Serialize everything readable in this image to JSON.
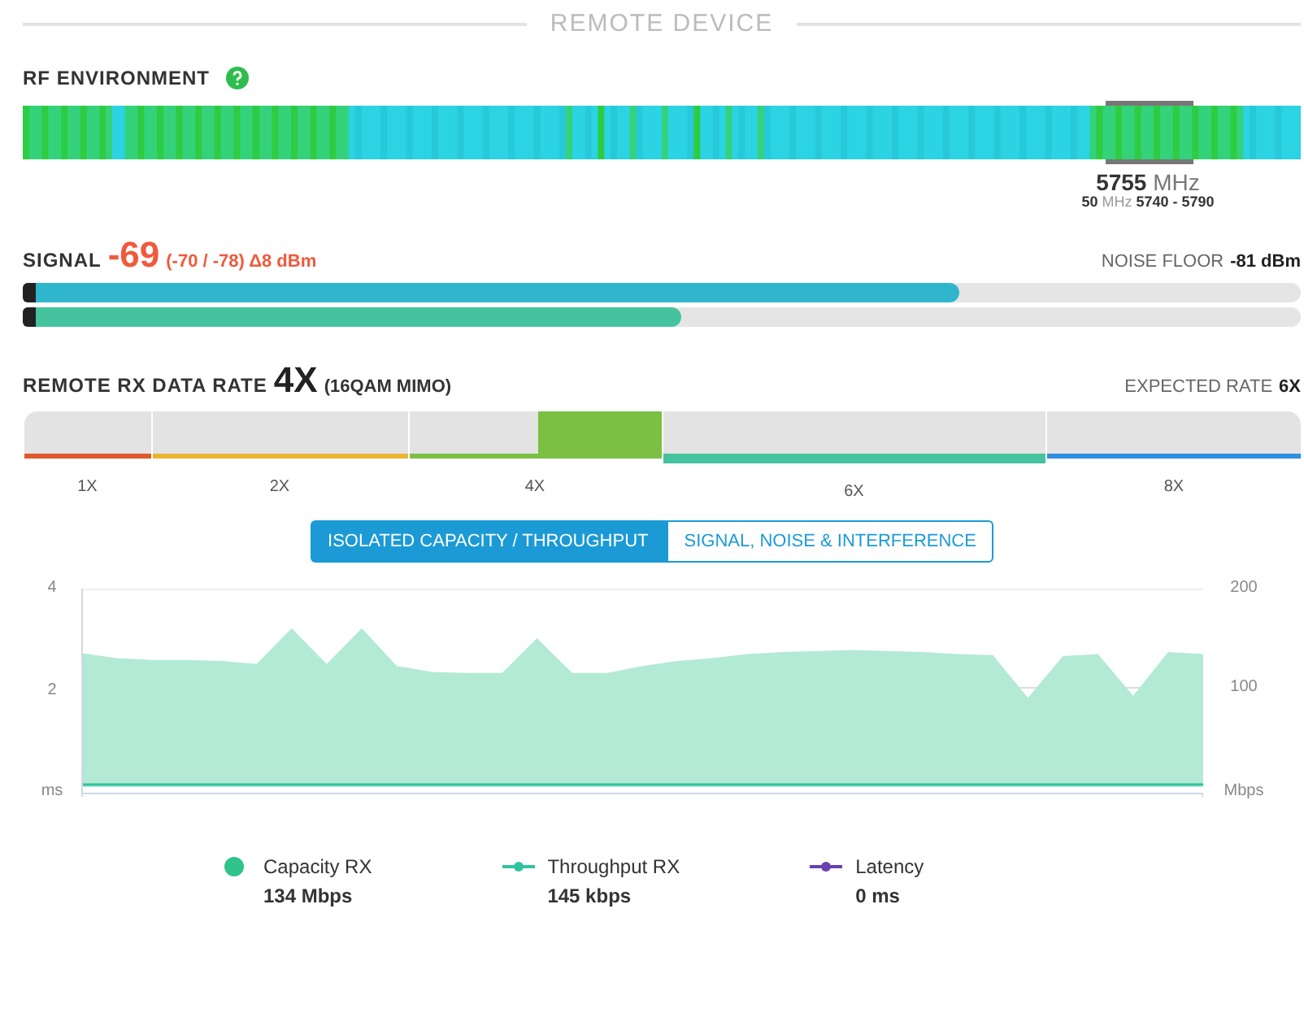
{
  "section_title": "REMOTE DEVICE",
  "rf_environment": {
    "title": "RF ENVIRONMENT",
    "frequency": "**5755** MHz",
    "channel": "**50** MHz **5740 - 5790**"
  },
  "signal": {
    "title": "SIGNAL",
    "value": "-69",
    "detail": "(-70 / -78) Δ8 dBm",
    "noise_label": "NOISE FLOOR",
    "noise_value": "-81 dBm",
    "chains": [
      {
        "level": 0.73,
        "color": "#2fb6cc"
      },
      {
        "level": 0.51,
        "color": "#45c29e"
      }
    ]
  },
  "data_rate": {
    "title": "REMOTE RX DATA RATE",
    "value": "4X",
    "detail": "(16QAM MIMO)",
    "expected_label": "EXPECTED RATE",
    "expected_value": "6X",
    "segments": [
      {
        "label": "1X",
        "color": "#e0582c",
        "selected": false,
        "expected": false
      },
      {
        "label": "2X",
        "color": "#e8b431",
        "selected": false,
        "expected": false
      },
      {
        "label": "4X",
        "color": "#7bc043",
        "selected": true,
        "expected": false
      },
      {
        "label": "6X",
        "color": "#45c29e",
        "selected": false,
        "expected": true
      },
      {
        "label": "8X",
        "color": "#2f8fe0",
        "selected": false,
        "expected": false
      }
    ]
  },
  "view_tabs": [
    {
      "label": "ISOLATED CAPACITY / THROUGHPUT",
      "selected": true
    },
    {
      "label": "SIGNAL, NOISE & INTERFERENCE",
      "selected": false
    }
  ],
  "chart": {
    "left_ticks": [
      "4",
      "2"
    ],
    "left_unit": "ms",
    "chart_data": {
      "type": "area",
      "ylabel": "Mbps",
      "ylim": [
        0,
        200
      ],
      "yticks": [
        {
          "value": 100,
          "label": "100"
        },
        {
          "value": 200,
          "label": "200"
        }
      ],
      "series": [
        {
          "name": "Capacity RX",
          "color": "#b3ead6",
          "values": [
            135,
            130,
            128,
            128,
            127,
            124,
            160,
            124,
            160,
            122,
            116,
            115,
            115,
            150,
            115,
            115,
            122,
            127,
            130,
            134,
            136,
            137,
            138,
            137,
            136,
            134,
            133,
            90,
            132,
            134,
            92,
            136,
            134
          ]
        },
        {
          "name": "Throughput RX",
          "type": "line",
          "color": "#2ec4a0",
          "values": [
            0,
            0,
            0,
            0,
            0,
            0,
            0,
            0,
            0,
            0,
            0,
            0,
            0,
            0,
            0,
            0,
            0,
            0,
            0,
            0,
            0,
            0,
            0,
            0,
            0,
            0,
            0,
            0,
            0,
            0,
            0,
            0,
            0
          ]
        }
      ]
    },
    "legend": [
      {
        "kind": "dot",
        "reading": "134 Mbps"
      },
      {
        "kind": "line",
        "reading": "145 kbps"
      },
      {
        "kind": "line",
        "name": "Latency",
        "color": "#6a3fb0",
        "reading": "0 ms"
      }
    ]
  }
}
